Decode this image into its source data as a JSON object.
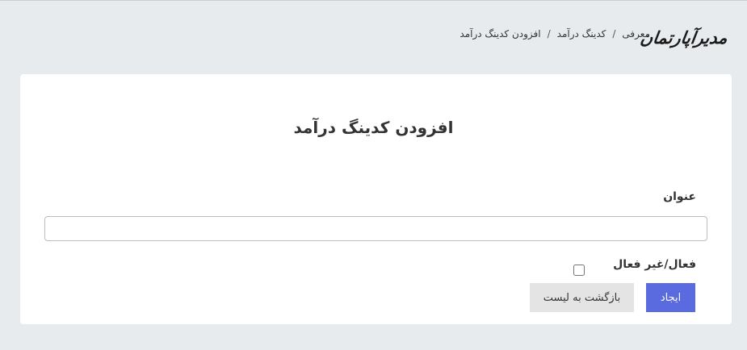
{
  "brand": {
    "logo_text": "مدیرآپارتمان"
  },
  "breadcrumb": {
    "items": [
      "معرفی",
      "کدینگ درآمد",
      "افزودن کدینگ درآمد"
    ],
    "separator": "/"
  },
  "form": {
    "title": "افزودن کدینگ درآمد",
    "title_field": {
      "label": "عنوان",
      "value": "",
      "placeholder": ""
    },
    "status_field": {
      "label": "فعال/غیر فعال",
      "checked": false
    },
    "buttons": {
      "create_label": "ایجاد",
      "back_label": "بازگشت به لیست"
    }
  },
  "colors": {
    "page_background": "#e8ebee",
    "card_background": "#ffffff",
    "primary_button": "#5a6be0",
    "secondary_button": "#e4e4e4"
  }
}
